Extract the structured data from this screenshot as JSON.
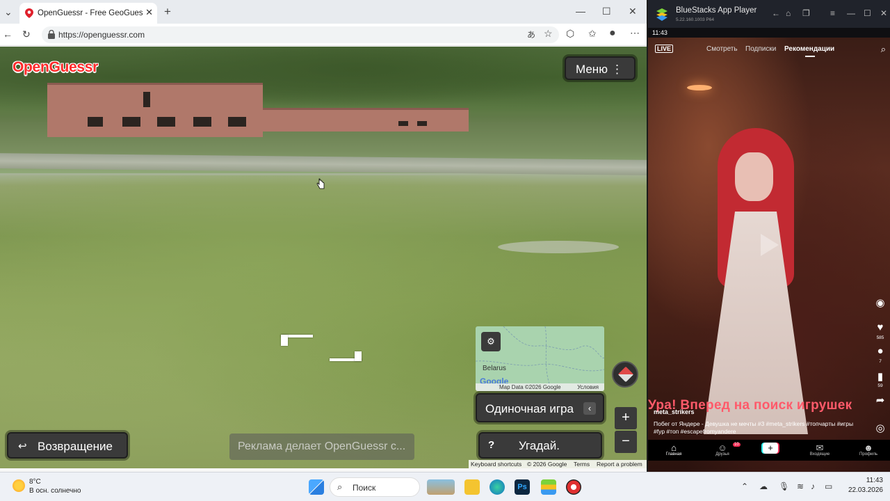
{
  "browser": {
    "tab_title": "OpenGuessr - Free GeoGuessr Alte",
    "url": "https://openguessr.com"
  },
  "game": {
    "logo": "OpenGuessr",
    "menu_label": "Меню",
    "back_label": "Возвращение",
    "ad_text": "Реклама делает OpenGuessr с...",
    "minimap_country": "Belarus",
    "minimap_google": "Google",
    "map_data": "Map Data ©2026 Google",
    "map_terms": "Условия",
    "mode_label": "Одиночная игра",
    "guess_label": "Угадай.",
    "guess_icon": "?",
    "zoom_in": "+",
    "zoom_out": "−",
    "attribution": {
      "shortcuts": "Keyboard shortcuts",
      "copyright": "© 2026 Google",
      "terms": "Terms",
      "report": "Report a problem"
    }
  },
  "bluestacks": {
    "title": "BlueStacks App Player",
    "version": "5.22.160.1003 P64",
    "status_time": "11:43",
    "tabs": {
      "live": "LIVE",
      "watch": "Смотреть",
      "subscriptions": "Подписки",
      "recommendations": "Рекомендации"
    },
    "subtitle": "Ура! Вперед на поиск игрушек",
    "author": "meta_strikers",
    "caption": "Побег от Яндере - Девушка не мечты #3 #meta_strikers #топчарты #игры #fyp #топ #escapefromyandere",
    "likes": "585",
    "comments": "7",
    "saves": "59",
    "nav": {
      "home": "Главная",
      "friends": "Друзья",
      "friends_badge": "10",
      "inbox": "Входящие",
      "profile": "Профиль"
    }
  },
  "taskbar": {
    "temperature": "8°C",
    "weather": "В осн. солнечно",
    "search_label": "Поиск",
    "time": "11:43",
    "date": "22.03.2026"
  }
}
